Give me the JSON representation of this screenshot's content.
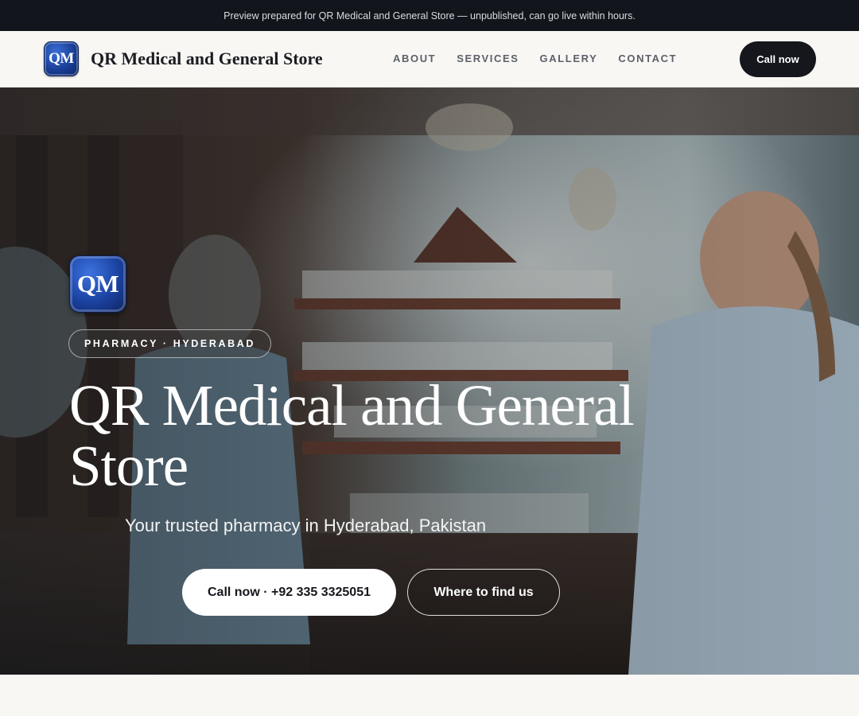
{
  "preview_bar": {
    "text": "Preview prepared for QR Medical and General Store — unpublished, can go live within hours."
  },
  "header": {
    "logo_text": "QM",
    "brand_name": "QR Medical and General Store",
    "nav": [
      {
        "label": "ABOUT"
      },
      {
        "label": "SERVICES"
      },
      {
        "label": "GALLERY"
      },
      {
        "label": "CONTACT"
      }
    ],
    "call_label": "Call now"
  },
  "hero": {
    "logo_text": "QM",
    "tag": "PHARMACY · HYDERABAD",
    "title": "QR Medical and General Store",
    "subtitle": "Your trusted pharmacy in Hyderabad, Pakistan",
    "primary_cta": "Call now · +92 335 3325051",
    "secondary_cta": "Where to find us"
  },
  "colors": {
    "topbar_bg": "#12151b",
    "header_bg": "#f8f7f4",
    "dark_button": "#15171c",
    "logo_blue": "#1a3f97"
  }
}
